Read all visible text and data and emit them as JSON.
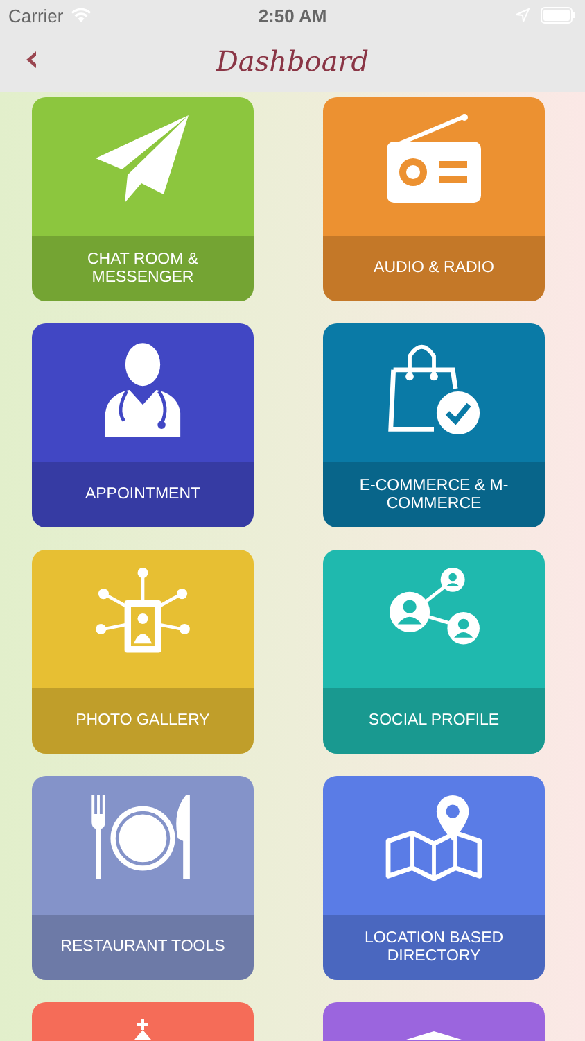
{
  "status_bar": {
    "carrier": "Carrier",
    "time": "2:50 AM"
  },
  "nav_bar": {
    "title": "Dashboard"
  },
  "tiles": [
    {
      "label": "CHAT ROOM & MESSENGER",
      "color": "#8cc63e"
    },
    {
      "label": "AUDIO & RADIO",
      "color": "#ec9131"
    },
    {
      "label": "APPOINTMENT",
      "color": "#4147c4"
    },
    {
      "label": "E-COMMERCE & M-COMMERCE",
      "color": "#0a7aa6"
    },
    {
      "label": "PHOTO GALLERY",
      "color": "#e7bf33"
    },
    {
      "label": "SOCIAL PROFILE",
      "color": "#1fb9ae"
    },
    {
      "label": "RESTAURANT TOOLS",
      "color": "#8493c9"
    },
    {
      "label": "LOCATION BASED DIRECTORY",
      "color": "#5a7ce6"
    },
    {
      "color": "#f56c58"
    },
    {
      "color": "#9b65de"
    }
  ]
}
